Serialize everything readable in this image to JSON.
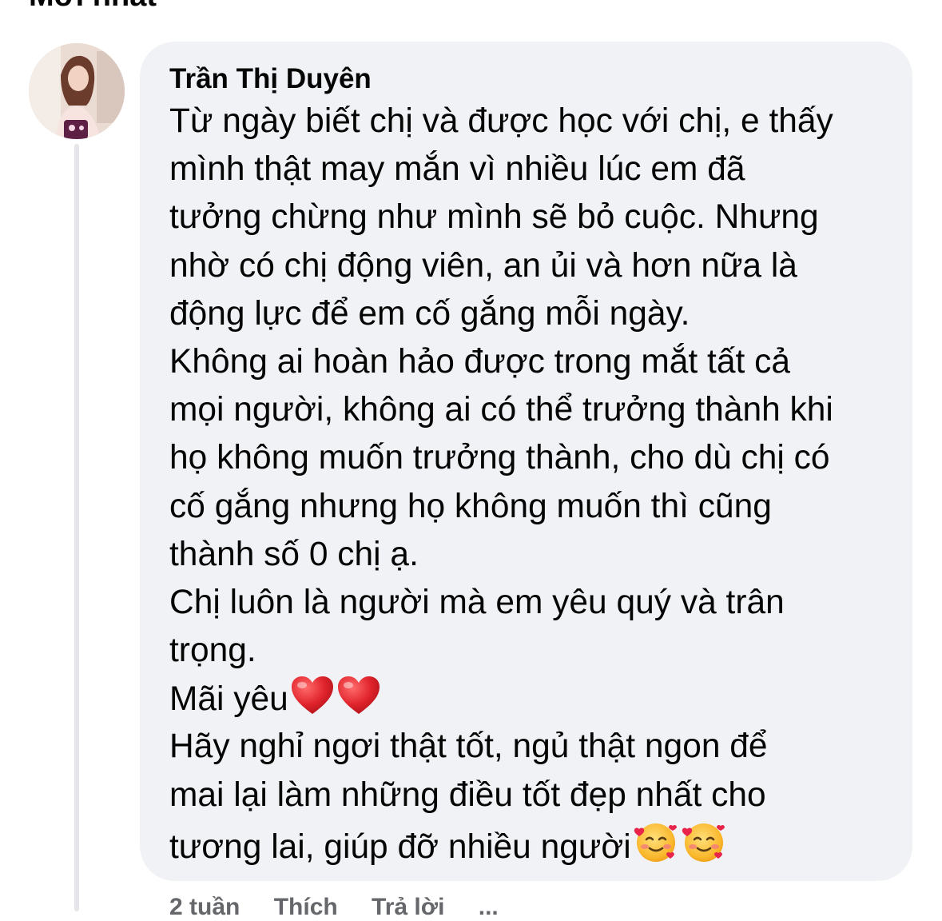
{
  "header": {
    "sort_label": "Mới nhất"
  },
  "comment": {
    "author": "Trần Thị Duyên",
    "lines": [
      "Từ ngày biết chị và được học với chị, e thấy",
      "mình thật may mắn vì nhiều lúc em đã",
      "tưởng chừng như mình sẽ bỏ cuộc. Nhưng",
      "nhờ có chị động viên, an ủi và hơn nữa là",
      "động lực để em cố gắng mỗi ngày.",
      "Không ai hoàn hảo được trong mắt tất cả",
      "mọi người, không ai có thể trưởng thành khi",
      "họ không muốn trưởng thành, cho dù chị có",
      "cố gắng nhưng họ không muốn thì cũng",
      "thành số 0 chị ạ.",
      "Chị luôn là người mà em yêu quý và trân",
      "trọng.",
      "Mãi yêu",
      "Hãy nghỉ ngơi thật tốt, ngủ thật ngon để",
      "mai lại làm những điều tốt đẹp nhất cho",
      "tương lai, giúp đỡ nhiều người"
    ],
    "emoji_line_12": [
      "red-heart-icon",
      "red-heart-icon"
    ],
    "emoji_line_15": [
      "smiling-face-with-hearts-icon",
      "smiling-face-with-hearts-icon"
    ],
    "actions": {
      "time": "2 tuần",
      "like": "Thích",
      "reply": "Trả lời",
      "more": "..."
    }
  },
  "colors": {
    "bubble_bg": "#f0f2f5",
    "text": "#050505",
    "thread_line": "#e4e6eb",
    "heart": "#e0242c"
  }
}
